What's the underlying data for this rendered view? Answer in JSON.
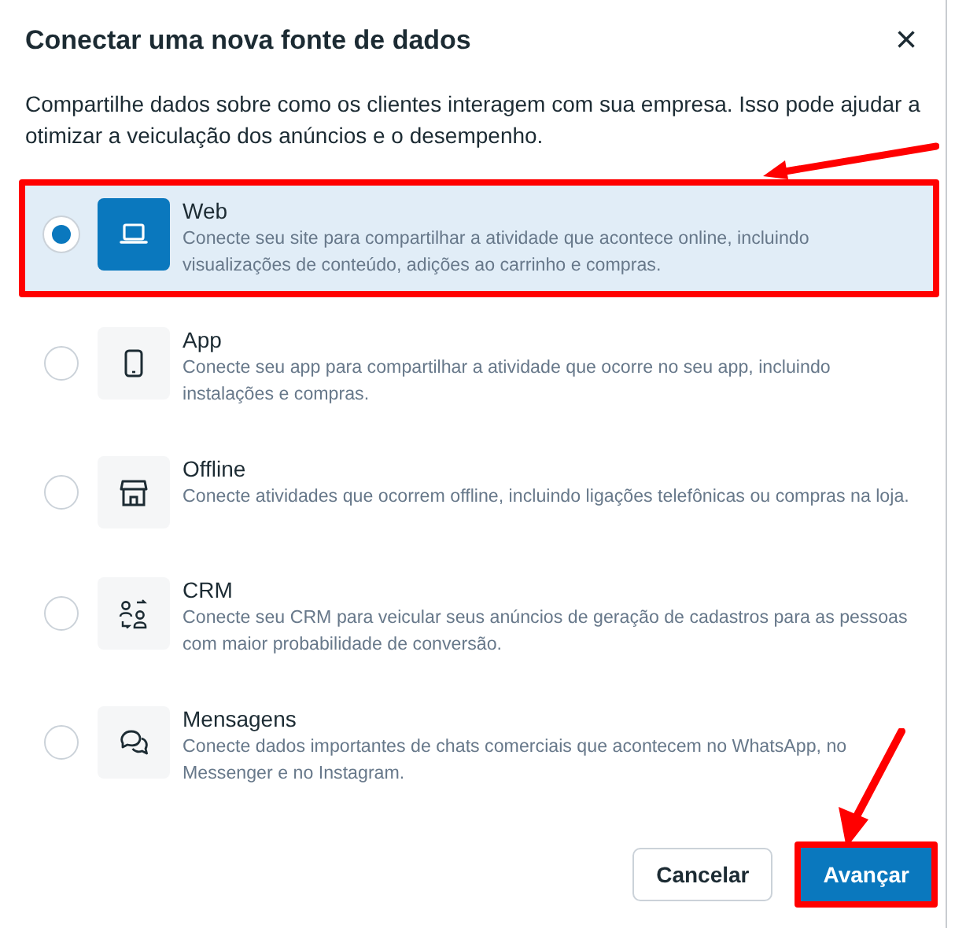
{
  "dialog": {
    "title": "Conectar uma nova fonte de dados",
    "close": "×",
    "description": "Compartilhe dados sobre como os clientes interagem com sua empresa. Isso pode ajudar a otimizar a veiculação dos anúncios e o desempenho."
  },
  "options": [
    {
      "kind": "web",
      "label": "Web",
      "description": "Conecte seu site para compartilhar a atividade que acontece online, incluindo visualizações de conteúdo, adições ao carrinho e compras.",
      "selected": true,
      "highlighted": true
    },
    {
      "kind": "app",
      "label": "App",
      "description": "Conecte seu app para compartilhar a atividade que ocorre no seu app, incluindo instalações e compras.",
      "selected": false,
      "highlighted": false
    },
    {
      "kind": "offline",
      "label": "Offline",
      "description": "Conecte atividades que ocorrem offline, incluindo ligações telefônicas ou compras na loja.",
      "selected": false,
      "highlighted": false
    },
    {
      "kind": "crm",
      "label": "CRM",
      "description": "Conecte seu CRM para veicular seus anúncios de geração de cadastros para as pessoas com maior probabilidade de conversão.",
      "selected": false,
      "highlighted": false
    },
    {
      "kind": "messages",
      "label": "Mensagens",
      "description": "Conecte dados importantes de chats comerciais que acontecem no WhatsApp, no Messenger e no Instagram.",
      "selected": false,
      "highlighted": false
    }
  ],
  "buttons": [
    {
      "kind": "secondary",
      "label": "Cancelar",
      "highlighted": false
    },
    {
      "kind": "primary",
      "label": "Avançar",
      "highlighted": true
    }
  ]
}
